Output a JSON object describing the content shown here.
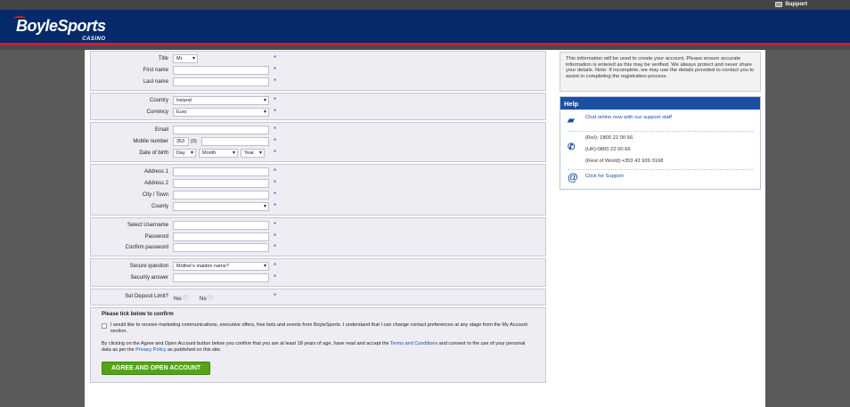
{
  "topbar": {
    "support_label": "Support"
  },
  "brand": {
    "name": "BoyleSports",
    "sub": "CASINO"
  },
  "form": {
    "personal": [
      {
        "label": "Title",
        "value": "Mr.",
        "type": "select",
        "w": 28
      },
      {
        "label": "First name",
        "value": "",
        "type": "text",
        "w": 108
      },
      {
        "label": "Last name",
        "value": "",
        "type": "text",
        "w": 108
      }
    ],
    "location": [
      {
        "label": "Country",
        "value": "Ireland",
        "type": "select",
        "w": 108
      },
      {
        "label": "Currency",
        "value": "Euro",
        "type": "select",
        "w": 108
      }
    ],
    "email_label": "Email",
    "mobile_label": "Mobile number",
    "mobile_code": "353",
    "mobile_zero": "(0)",
    "dob_label": "Date of birth",
    "dob_day": "Day",
    "dob_month": "Month",
    "dob_year": "Year",
    "address": [
      {
        "label": "Address 1",
        "value": "",
        "type": "text",
        "w": 108
      },
      {
        "label": "Address 2",
        "value": "",
        "type": "text",
        "w": 108
      },
      {
        "label": "City / Town",
        "value": "",
        "type": "text",
        "w": 108
      },
      {
        "label": "County",
        "value": "",
        "type": "select",
        "w": 108
      }
    ],
    "account": [
      {
        "label": "Select Username",
        "value": "",
        "type": "text",
        "w": 108
      },
      {
        "label": "Password",
        "value": "",
        "type": "text",
        "w": 108
      },
      {
        "label": "Confirm password",
        "value": "",
        "type": "text",
        "w": 108
      }
    ],
    "security": [
      {
        "label": "Secure question",
        "value": "Mother's maiden name?",
        "type": "select",
        "w": 108
      },
      {
        "label": "Security answer",
        "value": "",
        "type": "text",
        "w": 108
      }
    ],
    "deposit": {
      "label": "Set Deposit Limit?",
      "yes": "Yes",
      "no": "No"
    },
    "confirm": {
      "heading": "Please tick below to confirm",
      "marketing": "I would like to receive marketing communications, executive offers, free bets and events from BoyleSports. I understand that I can change contact preferences at any stage from the My Account section.",
      "disclaimer_a": "By clicking on the Agree and Open Account button below you confirm that you are at least 18 years of age, have read and accept the ",
      "terms": "Terms and Conditions",
      "disclaimer_b": " and consent to the use of your personal data as per the ",
      "privacy": "Privacy Policy",
      "disclaimer_c": " as published on this site.",
      "button": "AGREE AND OPEN ACCOUNT"
    }
  },
  "info_text": "This information will be used to create your account. Please ensure accurate information is entered as this may be verified. We always protect and never share your details. Note: If incomplete, we may use the details provided to contact you to assist in completing the registration process.",
  "help": {
    "title": "Help",
    "chat": "Chat online now with our support staff",
    "roi": "(RoI): 1800 22 00 66",
    "uk": "(UK):0800 22 00 66",
    "row": "(Rest of World):+353 42 939 3168",
    "support": "Click for Support"
  }
}
